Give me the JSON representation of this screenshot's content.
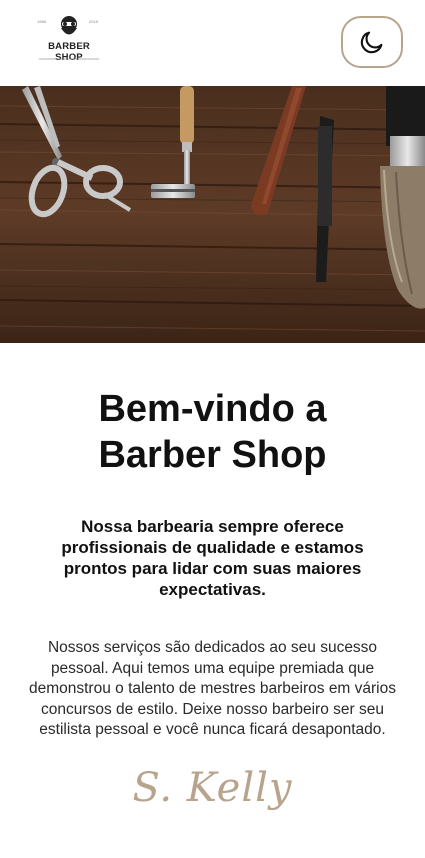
{
  "header": {
    "logo_text": "BARBER SHOP",
    "theme_toggle_icon": "moon-icon"
  },
  "hero": {
    "image": "barber-tools-on-wood",
    "tools": [
      "scissors-icon",
      "safety-razor-icon",
      "straight-razor-icon",
      "shaving-brush-icon"
    ]
  },
  "main": {
    "title": "Bem-vindo a Barber Shop",
    "lead": "Nossa barbearia sempre oferece profissionais de qualidade e estamos prontos para lidar com suas maiores expectativas.",
    "body": "Nossos serviços são dedicados ao seu sucesso pessoal. Aqui temos uma equipe premiada que demonstrou o talento de mestres barbeiros em vários concursos de estilo. Deixe nosso barbeiro ser seu estilista pessoal e você nunca ficará desapontado.",
    "signature": "S. Kelly"
  },
  "colors": {
    "accent": "#b8a48d",
    "wood_dark": "#3b2416",
    "wood_light": "#6e4a32"
  }
}
